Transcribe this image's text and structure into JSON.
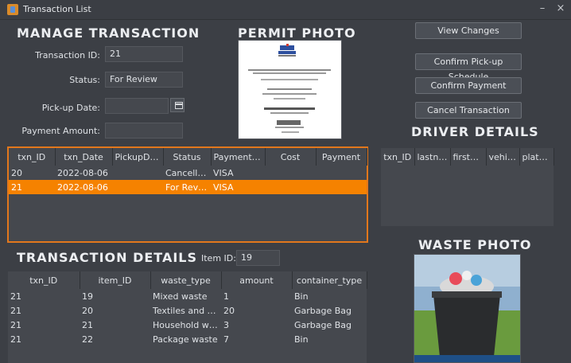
{
  "window": {
    "title": "Transaction List",
    "minimize": "–",
    "close": "×"
  },
  "manage": {
    "heading": "MANAGE TRANSACTION",
    "txn_id_label": "Transaction ID:",
    "txn_id_value": "21",
    "status_label": "Status:",
    "status_value": "For Review",
    "pickup_label": "Pick-up Date:",
    "pickup_value": "",
    "payment_label": "Payment Amount:",
    "payment_value": ""
  },
  "permit": {
    "heading": "PERMIT PHOTO"
  },
  "actions": {
    "view_changes": "View Changes",
    "confirm_pickup": "Confirm Pick-up Schedule",
    "confirm_payment": "Confirm Payment",
    "cancel_transaction": "Cancel Transaction"
  },
  "driver": {
    "heading": "DRIVER DETAILS",
    "columns": [
      "txn_ID",
      "lastna...",
      "firstna...",
      "vehicle",
      "plateno"
    ]
  },
  "transactions": {
    "columns": [
      "txn_ID",
      "txn_Date",
      "PickupDate",
      "Status",
      "Payment M...",
      "Cost",
      "Payment"
    ],
    "rows": [
      [
        "20",
        "2022-08-06",
        "",
        "Cancelled",
        "VISA",
        "",
        ""
      ],
      [
        "21",
        "2022-08-06",
        "",
        "For Review",
        "VISA",
        "",
        ""
      ]
    ],
    "selected_index": 1
  },
  "details": {
    "heading": "TRANSACTION DETAILS",
    "item_id_label": "Item ID:",
    "item_id_value": "19",
    "columns": [
      "txn_ID",
      "item_ID",
      "waste_type",
      "amount",
      "container_type"
    ],
    "rows": [
      [
        "21",
        "19",
        "Mixed waste",
        "1",
        "Bin"
      ],
      [
        "21",
        "20",
        "Textiles and Leat...",
        "20",
        "Garbage Bag"
      ],
      [
        "21",
        "21",
        "Household waste",
        "3",
        "Garbage Bag"
      ],
      [
        "21",
        "22",
        "Package waste",
        "7",
        "Bin"
      ]
    ]
  },
  "waste": {
    "heading": "WASTE PHOTO"
  },
  "colors": {
    "accent": "#f58200",
    "background": "#3c3f45",
    "panel": "#45484e"
  }
}
